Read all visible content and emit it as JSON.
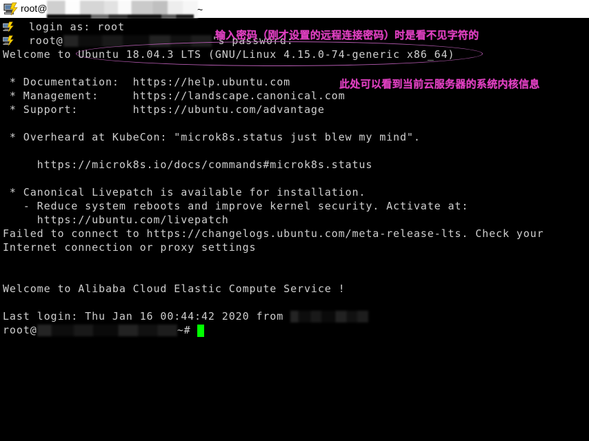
{
  "window": {
    "title_prefix": "root@",
    "title_suffix": "~",
    "icon": "putty-computer-icon",
    "redacted": true
  },
  "terminal": {
    "background_color": "#000000",
    "foreground_color": "#cfcfcf",
    "cursor_color": "#00ff00",
    "lines": [
      {
        "id": "l01",
        "text": "  login as: root",
        "icon": "putty-computer-icon"
      },
      {
        "id": "l02",
        "prefix": "  root@",
        "redacted": true,
        "suffix": "'s password:",
        "icon": "putty-computer-icon"
      },
      {
        "id": "l03",
        "text": "Welcome to Ubuntu 18.04.3 LTS (GNU/Linux 4.15.0-74-generic x86_64)"
      },
      {
        "id": "l04",
        "text": ""
      },
      {
        "id": "l05",
        "text": " * Documentation:  https://help.ubuntu.com"
      },
      {
        "id": "l06",
        "text": " * Management:     https://landscape.canonical.com"
      },
      {
        "id": "l07",
        "text": " * Support:        https://ubuntu.com/advantage"
      },
      {
        "id": "l08",
        "text": ""
      },
      {
        "id": "l09",
        "text": " * Overheard at KubeCon: \"microk8s.status just blew my mind\"."
      },
      {
        "id": "l10",
        "text": ""
      },
      {
        "id": "l11",
        "text": "     https://microk8s.io/docs/commands#microk8s.status"
      },
      {
        "id": "l12",
        "text": ""
      },
      {
        "id": "l13",
        "text": " * Canonical Livepatch is available for installation."
      },
      {
        "id": "l14",
        "text": "   - Reduce system reboots and improve kernel security. Activate at:"
      },
      {
        "id": "l15",
        "text": "     https://ubuntu.com/livepatch"
      },
      {
        "id": "l16",
        "text": "Failed to connect to https://changelogs.ubuntu.com/meta-release-lts. Check your"
      },
      {
        "id": "l17",
        "text": "Internet connection or proxy settings"
      },
      {
        "id": "l18",
        "text": ""
      },
      {
        "id": "l19",
        "text": ""
      },
      {
        "id": "l20",
        "text": "Welcome to Alibaba Cloud Elastic Compute Service !"
      },
      {
        "id": "l21",
        "text": ""
      },
      {
        "id": "l22",
        "prefix": "Last login: Thu Jan 16 00:44:42 2020 from ",
        "redacted": true,
        "suffix": ""
      },
      {
        "id": "l23",
        "prefix": "root@",
        "redacted": true,
        "suffix": "~# ",
        "cursor": true
      }
    ]
  },
  "annotations": {
    "color": "#e040c0",
    "ellipse_color": "#b45ab0",
    "items": [
      {
        "id": "a1",
        "text": "输入密码（刚才设置的远程连接密码）时是看不见字符的",
        "target": "password-prompt-line"
      },
      {
        "id": "a2",
        "text": "此处可以看到当前云服务器的系统内核信息",
        "target": "kernel-version-line"
      }
    ],
    "ellipse": {
      "id": "kernel-ellipse",
      "encircles": "Welcome to Ubuntu 18.04.3 LTS (GNU/Linux 4.15.0-74-generic x86_64)"
    }
  }
}
